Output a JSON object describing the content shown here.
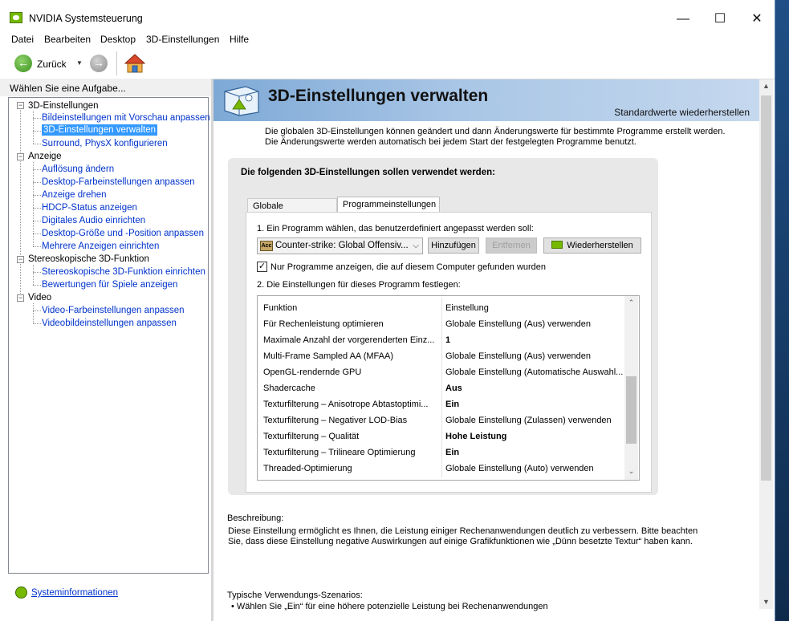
{
  "window": {
    "title": "NVIDIA Systemsteuerung",
    "minimize": "—",
    "maximize": "☐",
    "close": "✕"
  },
  "menu": [
    "Datei",
    "Bearbeiten",
    "Desktop",
    "3D-Einstellungen",
    "Hilfe"
  ],
  "toolbar": {
    "back_label": "Zurück",
    "back_icon": "←",
    "forward_icon": "→",
    "dropdown_icon": "▼"
  },
  "left_panel": {
    "header": "Wählen Sie eine Aufgabe...",
    "groups": [
      {
        "label": "3D-Einstellungen",
        "items": [
          "Bildeinstellungen mit Vorschau anpassen",
          "3D-Einstellungen verwalten",
          "Surround, PhysX konfigurieren"
        ]
      },
      {
        "label": "Anzeige",
        "items": [
          "Auflösung ändern",
          "Desktop-Farbeinstellungen anpassen",
          "Anzeige drehen",
          "HDCP-Status anzeigen",
          "Digitales Audio einrichten",
          "Desktop-Größe und -Position anpassen",
          "Mehrere Anzeigen einrichten"
        ]
      },
      {
        "label": "Stereoskopische 3D-Funktion",
        "items": [
          "Stereoskopische 3D-Funktion einrichten",
          "Bewertungen für Spiele anzeigen"
        ]
      },
      {
        "label": "Video",
        "items": [
          "Video-Farbeinstellungen anpassen",
          "Videobildeinstellungen anpassen"
        ]
      }
    ],
    "selected_item": "3D-Einstellungen verwalten",
    "expander_symbol": "−",
    "sysinfo": "Systeminformationen"
  },
  "main": {
    "title": "3D-Einstellungen verwalten",
    "restore_defaults": "Standardwerte wiederherstellen",
    "intro": "Die globalen 3D-Einstellungen können geändert und dann Änderungswerte für bestimmte Programme erstellt werden. Die Änderungswerte werden automatisch bei jedem Start der festgelegten Programme benutzt.",
    "panel_title": "Die folgenden 3D-Einstellungen sollen verwendet werden:",
    "tabs": [
      "Globale Einstellungen",
      "Programmeinstellungen"
    ],
    "active_tab": "Programmeinstellungen",
    "step1": "1. Ein Programm wählen, das benutzerdefiniert angepasst werden soll:",
    "program_select": {
      "value": "Counter-strike: Global Offensiv...",
      "icon_text": "Acc",
      "arrow": "⌵"
    },
    "buttons": {
      "add": "Hinzufügen",
      "remove": "Entfernen",
      "restore": "Wiederherstellen"
    },
    "checkbox": {
      "label": "Nur Programme anzeigen, die auf diesem Computer gefunden wurden",
      "checked": true,
      "mark": "✓"
    },
    "step2": "2. Die Einstellungen für dieses Programm festlegen:",
    "table": {
      "headers": [
        "Funktion",
        "Einstellung"
      ],
      "rows": [
        {
          "feature": "Für Rechenleistung optimieren",
          "setting": "Globale Einstellung (Aus) verwenden",
          "bold": false
        },
        {
          "feature": "Maximale Anzahl der vorgerenderten Einz...",
          "setting": "1",
          "bold": true
        },
        {
          "feature": "Multi-Frame Sampled AA (MFAA)",
          "setting": "Globale Einstellung (Aus) verwenden",
          "bold": false
        },
        {
          "feature": "OpenGL-rendernde GPU",
          "setting": "Globale Einstellung (Automatische Auswahl...",
          "bold": false
        },
        {
          "feature": "Shadercache",
          "setting": "Aus",
          "bold": true
        },
        {
          "feature": "Texturfilterung – Anisotrope Abtastoptimi...",
          "setting": "Ein",
          "bold": true
        },
        {
          "feature": "Texturfilterung – Negativer LOD-Bias",
          "setting": "Globale Einstellung (Zulassen) verwenden",
          "bold": false
        },
        {
          "feature": "Texturfilterung – Qualität",
          "setting": "Hohe Leistung",
          "bold": true
        },
        {
          "feature": "Texturfilterung – Trilineare Optimierung",
          "setting": "Ein",
          "bold": true
        },
        {
          "feature": "Threaded-Optimierung",
          "setting": "Globale Einstellung (Auto) verwenden",
          "bold": false
        }
      ],
      "scroll_up": "⌃",
      "scroll_down": "⌄"
    },
    "description_title": "Beschreibung:",
    "description": "Diese Einstellung ermöglicht es Ihnen, die Leistung einiger Rechenanwendungen deutlich zu verbessern. Bitte beachten Sie, dass diese Einstellung negative Auswirkungen auf einige Grafikfunktionen wie „Dünn besetzte Textur“ haben kann.",
    "typical_title": "Typische Verwendungs-Szenarios:",
    "typical_items": [
      "• Wählen Sie „Ein“ für eine höhere potenzielle Leistung bei Rechenanwendungen"
    ]
  },
  "scrollbar": {
    "up": "▲",
    "down": "▼"
  }
}
